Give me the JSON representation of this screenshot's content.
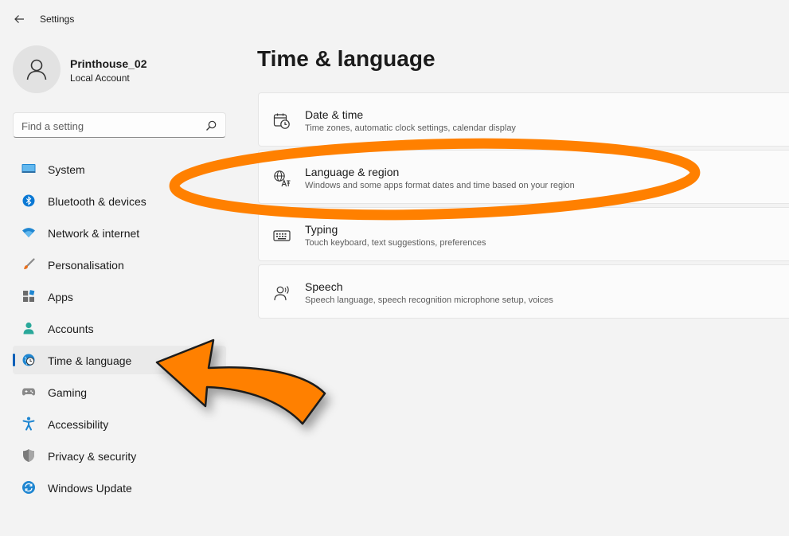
{
  "window": {
    "title": "Settings"
  },
  "profile": {
    "name": "Printhouse_02",
    "account_type": "Local Account"
  },
  "search": {
    "placeholder": "Find a setting"
  },
  "nav": {
    "items": [
      {
        "label": "System",
        "icon": "monitor-icon"
      },
      {
        "label": "Bluetooth & devices",
        "icon": "bluetooth-icon"
      },
      {
        "label": "Network & internet",
        "icon": "wifi-icon"
      },
      {
        "label": "Personalisation",
        "icon": "brush-icon"
      },
      {
        "label": "Apps",
        "icon": "apps-icon"
      },
      {
        "label": "Accounts",
        "icon": "person-icon"
      },
      {
        "label": "Time & language",
        "icon": "clock-globe-icon",
        "active": true
      },
      {
        "label": "Gaming",
        "icon": "gamepad-icon"
      },
      {
        "label": "Accessibility",
        "icon": "accessibility-icon"
      },
      {
        "label": "Privacy & security",
        "icon": "shield-icon"
      },
      {
        "label": "Windows Update",
        "icon": "sync-icon"
      }
    ]
  },
  "main": {
    "title": "Time & language",
    "cards": [
      {
        "title": "Date & time",
        "subtitle": "Time zones, automatic clock settings, calendar display",
        "icon": "calendar-clock-icon"
      },
      {
        "title": "Language & region",
        "subtitle": "Windows and some apps format dates and time based on your region",
        "icon": "language-globe-icon"
      },
      {
        "title": "Typing",
        "subtitle": "Touch keyboard, text suggestions, preferences",
        "icon": "keyboard-icon"
      },
      {
        "title": "Speech",
        "subtitle": "Speech language, speech recognition microphone setup, voices",
        "icon": "speech-icon"
      }
    ]
  },
  "colors": {
    "accent": "#005fb8",
    "annotation_orange": "#ff8000",
    "background": "#f3f3f3",
    "card": "#fbfbfb"
  }
}
